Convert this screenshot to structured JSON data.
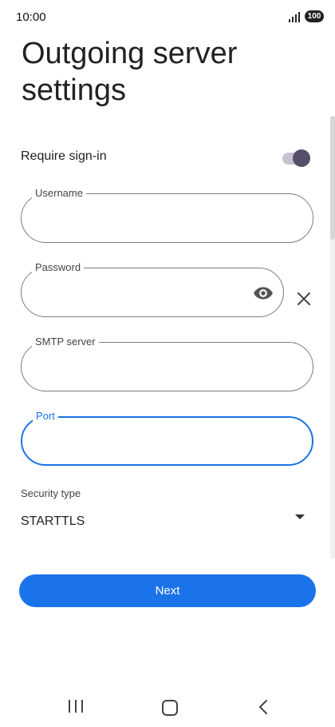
{
  "status_bar": {
    "time": "10:00",
    "battery": "100"
  },
  "header": {
    "title": "Outgoing server settings"
  },
  "require_signin": {
    "label": "Require sign-in",
    "enabled": true
  },
  "fields": {
    "username": {
      "label": "Username",
      "value": ""
    },
    "password": {
      "label": "Password",
      "value": ""
    },
    "smtp_server": {
      "label": "SMTP server",
      "value": ""
    },
    "port": {
      "label": "Port",
      "value": "",
      "focused": true
    }
  },
  "security": {
    "label": "Security type",
    "selected": "STARTTLS"
  },
  "buttons": {
    "next_label": "Next"
  },
  "icons": {
    "password_visibility": "eye-icon",
    "password_clear": "close-icon",
    "dropdown": "dropdown-arrow-icon",
    "nav_recents": "recents-icon",
    "nav_home": "home-icon",
    "nav_back": "back-icon"
  },
  "colors": {
    "accent": "#1a73e8",
    "toggle_thumb": "#574e6b",
    "toggle_track": "#c5c3cf"
  }
}
